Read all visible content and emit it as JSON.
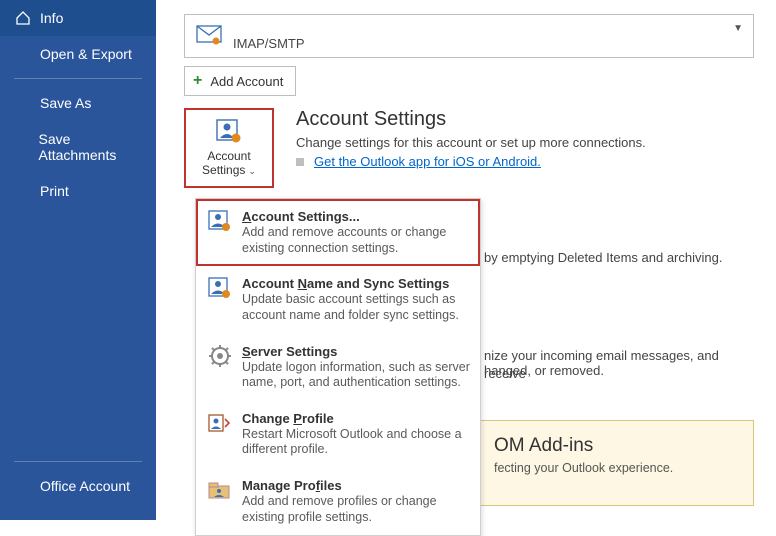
{
  "sidebar": {
    "items": [
      {
        "label": "Info"
      },
      {
        "label": "Open & Export"
      },
      {
        "label": "Save As"
      },
      {
        "label": "Save Attachments"
      },
      {
        "label": "Print"
      }
    ],
    "bottom": {
      "label": "Office Account"
    }
  },
  "account_picker": {
    "protocol": "IMAP/SMTP"
  },
  "add_account": {
    "label": "Add Account"
  },
  "settings_tile": {
    "line1": "Account",
    "line2": "Settings"
  },
  "account_settings": {
    "heading": "Account Settings",
    "subtitle": "Change settings for this account or set up more connections.",
    "link": "Get the Outlook app for iOS or Android."
  },
  "dropdown": {
    "items": [
      {
        "title": "Account Settings...",
        "desc": "Add and remove accounts or change existing connection settings."
      },
      {
        "title": "Account Name and Sync Settings",
        "desc": "Update basic account settings such as account name and folder sync settings."
      },
      {
        "title": "Server Settings",
        "desc": "Update logon information, such as server name, port, and authentication settings."
      },
      {
        "title": "Change Profile",
        "desc": "Restart Microsoft Outlook and choose a different profile."
      },
      {
        "title": "Manage Profiles",
        "desc": "Add and remove profiles or change existing profile settings."
      }
    ]
  },
  "background": {
    "frag1": "by emptying Deleted Items and archiving.",
    "frag2": "nize your incoming email messages, and receive",
    "frag3": "hanged, or removed."
  },
  "addins": {
    "heading_suffix": "OM Add-ins",
    "desc_suffix": "fecting your Outlook experience.",
    "badge": "Add-ins"
  }
}
